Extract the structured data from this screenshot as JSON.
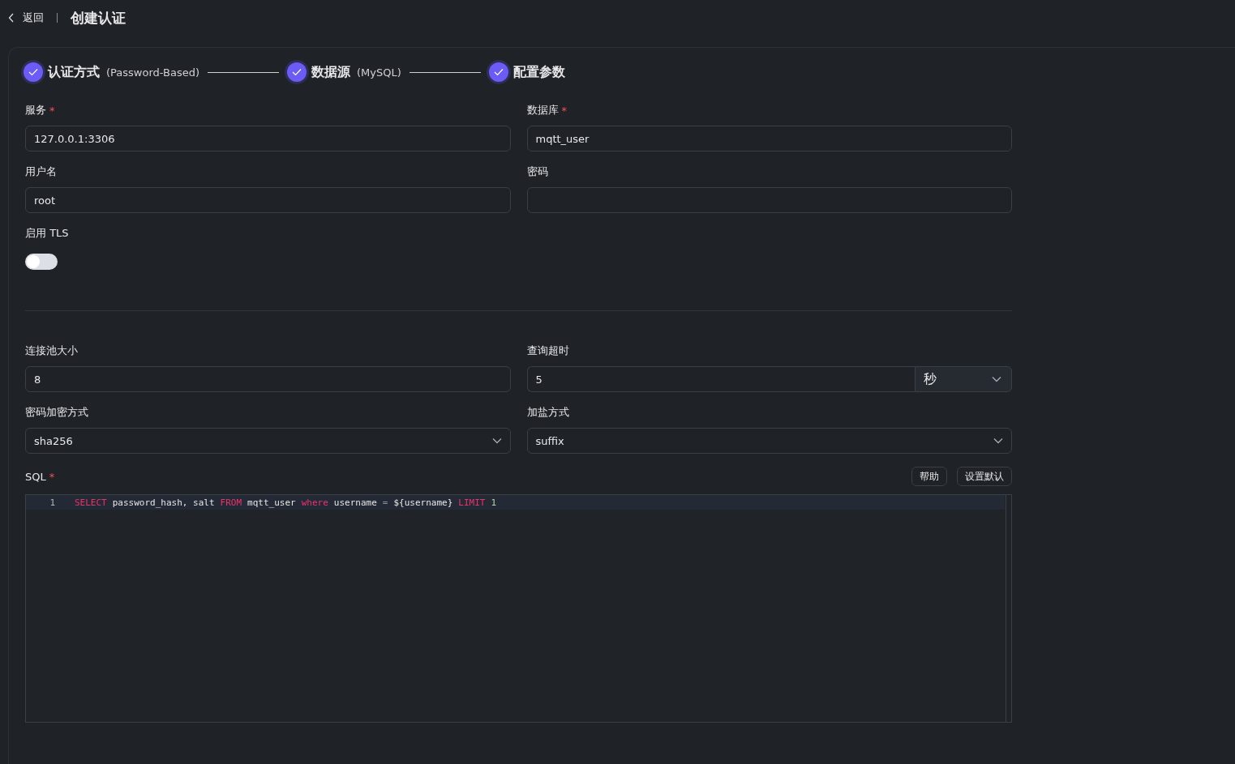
{
  "header": {
    "back_label": "返回",
    "title": "创建认证"
  },
  "steps": [
    {
      "title": "认证方式",
      "subtitle": "(Password-Based)",
      "done": true
    },
    {
      "title": "数据源",
      "subtitle": "(MySQL)",
      "done": true
    },
    {
      "title": "配置参数",
      "done": true
    }
  ],
  "connection_fields": [
    {
      "kind": "text",
      "label": "服务",
      "required_mark": "*",
      "value": "127.0.0.1:3306"
    },
    {
      "kind": "text",
      "label": "数据库",
      "required_mark": "*",
      "value": "mqtt_user"
    },
    {
      "kind": "text",
      "label": "用户名",
      "value": "root"
    },
    {
      "kind": "text",
      "label": "密码"
    },
    {
      "kind": "toggle",
      "label": "启用 TLS",
      "on": false
    }
  ],
  "option_fields": [
    {
      "kind": "text",
      "label": "连接池大小",
      "value": "8"
    },
    {
      "kind": "unit",
      "label": "查询超时",
      "value": "5",
      "unit": "秒"
    },
    {
      "kind": "select",
      "label": "密码加密方式",
      "value": "sha256"
    },
    {
      "kind": "select",
      "label": "加盐方式",
      "value": "suffix"
    }
  ],
  "sql": {
    "label": "SQL",
    "required_mark": "*",
    "buttons": [
      "帮助",
      "设置默认"
    ],
    "lines": [
      {
        "number": "1",
        "tokens": [
          {
            "kind": "keyword",
            "text": "SELECT"
          },
          {
            "kind": "plain",
            "text": "password_hash, salt"
          },
          {
            "kind": "keyword",
            "text": "FROM"
          },
          {
            "kind": "plain",
            "text": "mqtt_user"
          },
          {
            "kind": "keyword",
            "text": "where"
          },
          {
            "kind": "plain",
            "text": "username"
          },
          {
            "kind": "operator",
            "text": "="
          },
          {
            "kind": "plain",
            "text": "${username}"
          },
          {
            "kind": "keyword",
            "text": "LIMIT"
          },
          {
            "kind": "number",
            "text": "1"
          }
        ]
      }
    ]
  }
}
